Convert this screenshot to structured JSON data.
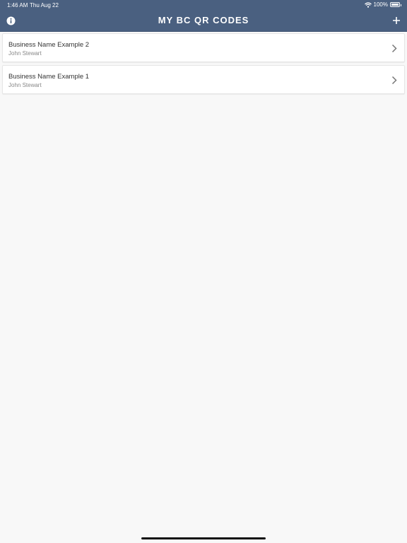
{
  "status": {
    "time": "1:46 AM",
    "date": "Thu Aug 22",
    "battery": "100%"
  },
  "header": {
    "title": "MY BC QR CODES"
  },
  "icons": {
    "info": "info-icon",
    "add": "plus-icon",
    "wifi": "wifi-icon",
    "chevron": "chevron-right-icon"
  },
  "colors": {
    "header_bg": "#4a6080",
    "background": "#f8f8f8"
  },
  "items": [
    {
      "title": "Business Name Example 2",
      "subtitle": "John Stewart"
    },
    {
      "title": "Business Name Example 1",
      "subtitle": "John Stewart"
    }
  ]
}
